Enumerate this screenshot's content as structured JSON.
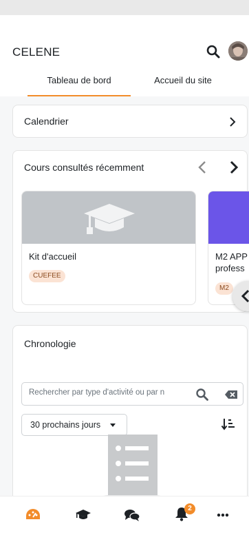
{
  "app": {
    "title": "CELENE"
  },
  "tabs": [
    {
      "label": "Tableau de bord",
      "active": true
    },
    {
      "label": "Accueil du site",
      "active": false
    }
  ],
  "calendar": {
    "title": "Calendrier"
  },
  "recent_courses": {
    "title": "Cours consultés récemment",
    "courses": [
      {
        "name": "Kit d'accueil",
        "category": "CUEFEE"
      },
      {
        "name_line1": "M2 APP",
        "name_line2": "profess",
        "category": "M2"
      }
    ]
  },
  "timeline": {
    "title": "Chronologie",
    "search_placeholder": "Rechercher par type d'activité ou par n",
    "filter_selected": "30 prochains jours"
  },
  "bottom_nav": {
    "items": [
      {
        "icon": "dashboard-icon"
      },
      {
        "icon": "graduation-cap-icon"
      },
      {
        "icon": "chat-icon"
      },
      {
        "icon": "bell-icon",
        "badge": "2"
      },
      {
        "icon": "more-icon"
      }
    ]
  },
  "colors": {
    "accent": "#f28c2a",
    "badge_bg": "#fbe3d4",
    "course_placeholder": "#c0c4c8",
    "course_purple": "#6b55e8"
  }
}
